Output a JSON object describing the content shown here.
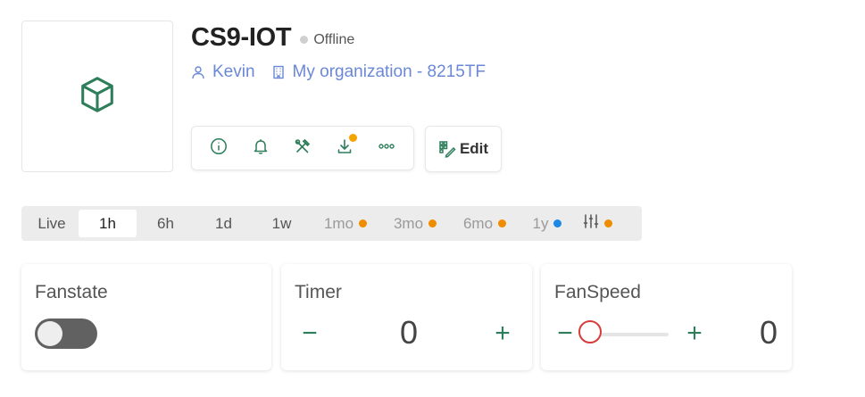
{
  "device": {
    "name": "CS9-IOT",
    "status": "Offline",
    "status_color": "#cfcfcf",
    "owner": "Kevin",
    "organization": "My organization - 8215TF",
    "icon": "cube-icon"
  },
  "actions": [
    {
      "name": "info-icon"
    },
    {
      "name": "bell-icon"
    },
    {
      "name": "tools-icon"
    },
    {
      "name": "download-icon",
      "badge_color": "#f5a300"
    },
    {
      "name": "more-icon"
    }
  ],
  "edit_label": "Edit",
  "timebar": {
    "items": [
      {
        "label": "Live",
        "active": false,
        "locked": false
      },
      {
        "label": "1h",
        "active": true,
        "locked": false
      },
      {
        "label": "6h",
        "active": false,
        "locked": false
      },
      {
        "label": "1d",
        "active": false,
        "locked": false
      },
      {
        "label": "1w",
        "active": false,
        "locked": false
      },
      {
        "label": "1mo",
        "active": false,
        "locked": true,
        "dot_color": "#f08c00"
      },
      {
        "label": "3mo",
        "active": false,
        "locked": true,
        "dot_color": "#f08c00"
      },
      {
        "label": "6mo",
        "active": false,
        "locked": true,
        "dot_color": "#f08c00"
      },
      {
        "label": "1y",
        "active": false,
        "locked": true,
        "dot_color": "#1e88e5"
      }
    ],
    "filter_icon": "sliders-icon",
    "filter_dot_color": "#f08c00"
  },
  "widgets": {
    "fanstate": {
      "title": "Fanstate",
      "on": false
    },
    "timer": {
      "title": "Timer",
      "value": "0",
      "minus": "−",
      "plus": "+"
    },
    "fanspeed": {
      "title": "FanSpeed",
      "value": "0",
      "minus": "−",
      "plus": "+",
      "slider_fraction": 0
    }
  },
  "colors": {
    "accent_green": "#2e7d5b",
    "link_blue": "#6a88d6",
    "slider_thumb": "#d83b3b"
  }
}
